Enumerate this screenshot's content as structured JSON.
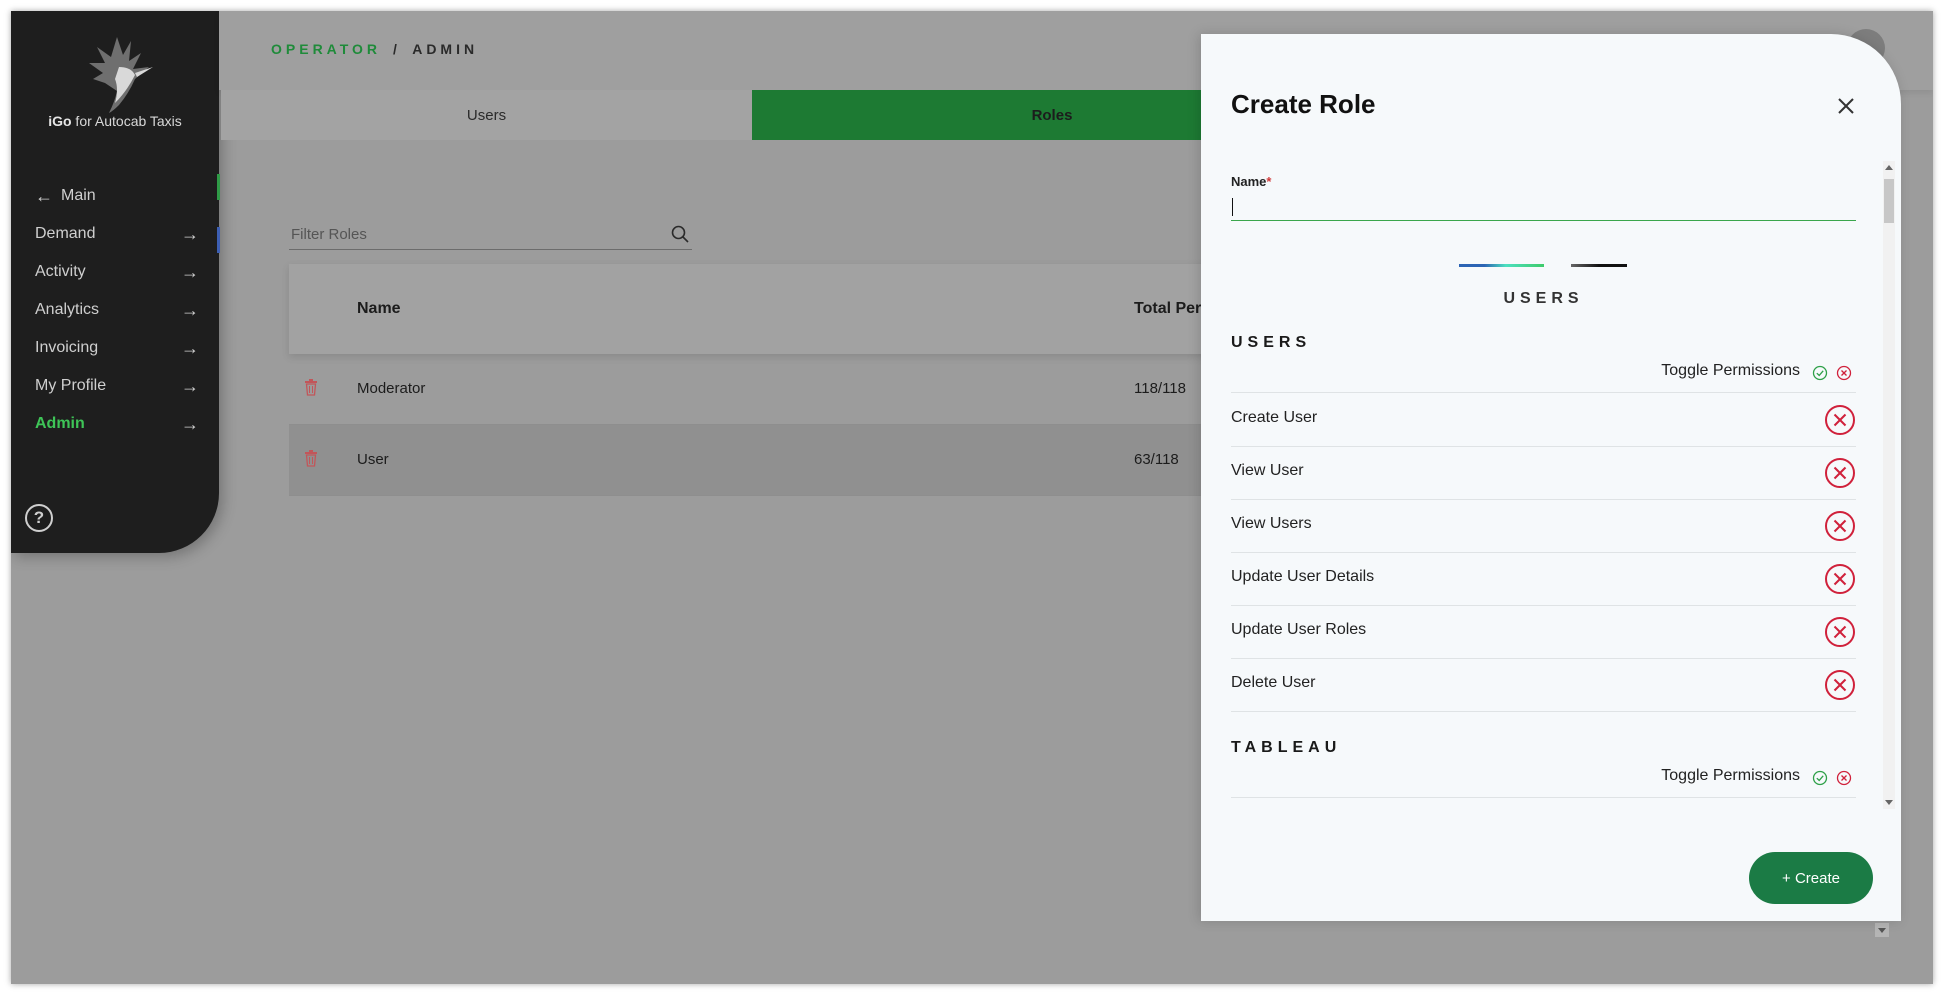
{
  "app": {
    "name_brand": "iGo",
    "name_rest": " for Autocab Taxis"
  },
  "breadcrumb": {
    "first": "OPERATOR",
    "separator": "/",
    "second": "ADMIN"
  },
  "sidebar": {
    "main_label": "Main",
    "items": [
      {
        "label": "Demand"
      },
      {
        "label": "Activity"
      },
      {
        "label": "Analytics"
      },
      {
        "label": "Invoicing"
      },
      {
        "label": "My Profile"
      },
      {
        "label": "Admin"
      }
    ],
    "help": "?"
  },
  "tabs": [
    {
      "label": "Users"
    },
    {
      "label": "Roles"
    }
  ],
  "filter": {
    "placeholder": "Filter Roles"
  },
  "table": {
    "headers": [
      "Name",
      "Total Perm"
    ],
    "rows": [
      {
        "name": "Moderator",
        "total": "118/118"
      },
      {
        "name": "User",
        "total": "63/118"
      }
    ]
  },
  "modal": {
    "title": "Create Role",
    "name_label": "Name",
    "required_mark": "*",
    "section_center": "USERS",
    "groups": [
      {
        "title": "USERS",
        "toggle_label": "Toggle Permissions",
        "permissions": [
          "Create User",
          "View User",
          "View Users",
          "Update User Details",
          "Update User Roles",
          "Delete User"
        ]
      },
      {
        "title": "TABLEAU",
        "toggle_label": "Toggle Permissions",
        "permissions": []
      }
    ],
    "create_label": "+ Create"
  },
  "colors": {
    "accent_green": "#3ec457",
    "roles_tab": "#1d7a33",
    "create_button": "#1b7b45",
    "deny_red": "#d0213b"
  }
}
